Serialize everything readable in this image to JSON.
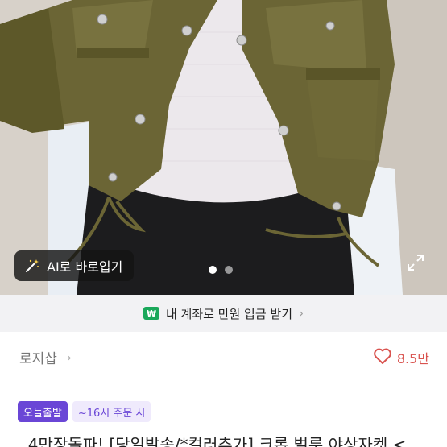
{
  "photo": {
    "ai_button_label": "AI로 바로입기",
    "icons": {
      "ai": "magic-wand-icon",
      "expand": "expand-icon"
    },
    "pagination": {
      "total": 2,
      "current": 1
    }
  },
  "promo": {
    "badge": "₩",
    "text": "내 계좌로 만원 입금 받기",
    "chevron": "›",
    "colors": {
      "badge": "#1aa85a",
      "background": "#f2f2f4"
    }
  },
  "shop": {
    "name": "로지샵",
    "chevron": "›",
    "likes": "8.5만",
    "icons": {
      "like": "heart-outline-icon"
    },
    "colors": {
      "like": "#d9534f"
    }
  },
  "product": {
    "badge_primary": "오늘출발",
    "badge_secondary": "~16시 주문 시",
    "title": "..4만장돌파! [당일발송/*컬러추가] 크롭 벌룬 야상자켓 <",
    "colors": {
      "accent": "#6a46d6"
    }
  }
}
